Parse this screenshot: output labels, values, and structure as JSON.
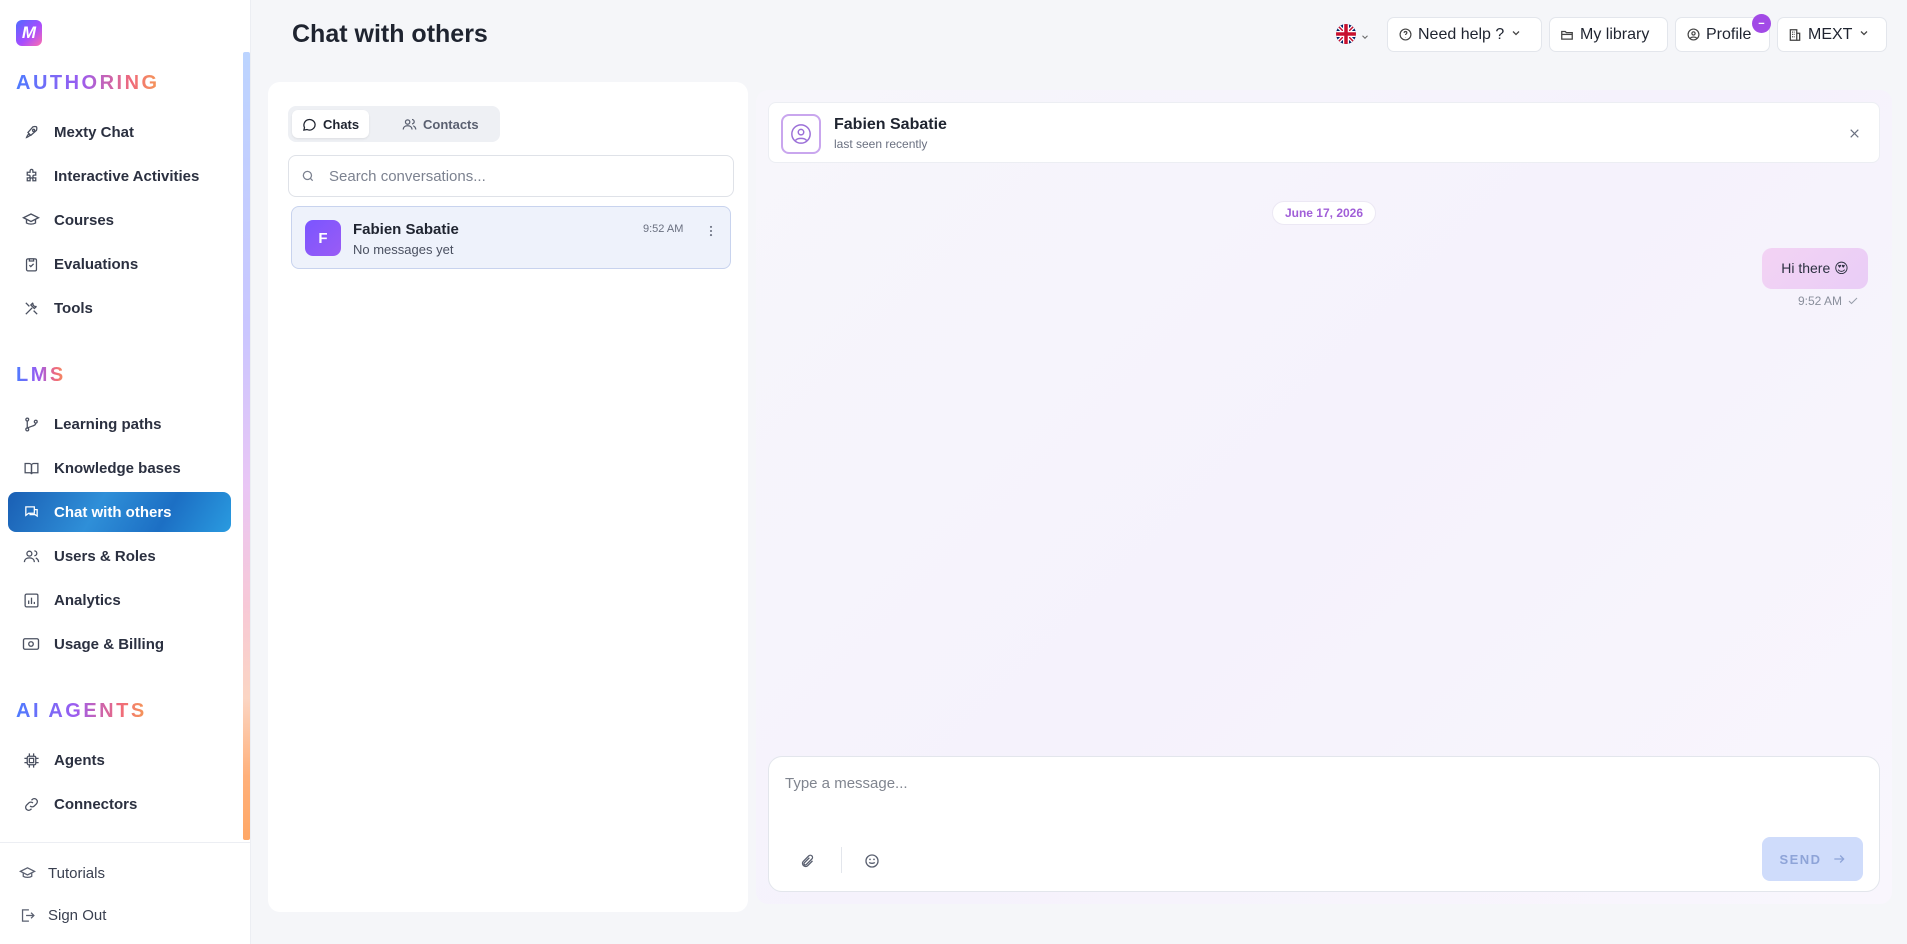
{
  "sidebar": {
    "logo_letter": "M",
    "sections": [
      {
        "title": "AUTHORING",
        "items": [
          "Mexty Chat",
          "Interactive Activities",
          "Courses",
          "Evaluations",
          "Tools"
        ]
      },
      {
        "title": "LMS",
        "items": [
          "Learning paths",
          "Knowledge bases",
          "Chat with others",
          "Users & Roles",
          "Analytics",
          "Usage & Billing"
        ]
      },
      {
        "title": "AI AGENTS",
        "items": [
          "Agents",
          "Connectors"
        ]
      }
    ],
    "active_item": "Chat with others",
    "footer": [
      "Tutorials",
      "Sign Out"
    ]
  },
  "header": {
    "title": "Chat with others",
    "language_flag": "uk-flag-icon",
    "help_label": "Need help ?",
    "library_label": "My library",
    "profile_label": "Profile",
    "profile_badge": "−",
    "org_label": "MEXT"
  },
  "chat_list": {
    "tabs": [
      "Chats",
      "Contacts"
    ],
    "active_tab": "Chats",
    "search_placeholder": "Search conversations...",
    "conversations": [
      {
        "initial": "F",
        "name": "Fabien Sabatie",
        "preview": "No messages yet",
        "time": "9:52 AM"
      }
    ]
  },
  "conversation": {
    "contact_name": "Fabien Sabatie",
    "contact_status": "last seen recently",
    "date_label": "June 17, 2026",
    "messages": [
      {
        "text": "Hi there 😍",
        "time": "9:52 AM",
        "outgoing": true
      }
    ],
    "composer_placeholder": "Type a message...",
    "send_label": "SEND"
  },
  "colors": {
    "accent_purple": "#a24ae6",
    "active_nav": "#1a5fb4",
    "send_button": "#cfdcfb"
  }
}
